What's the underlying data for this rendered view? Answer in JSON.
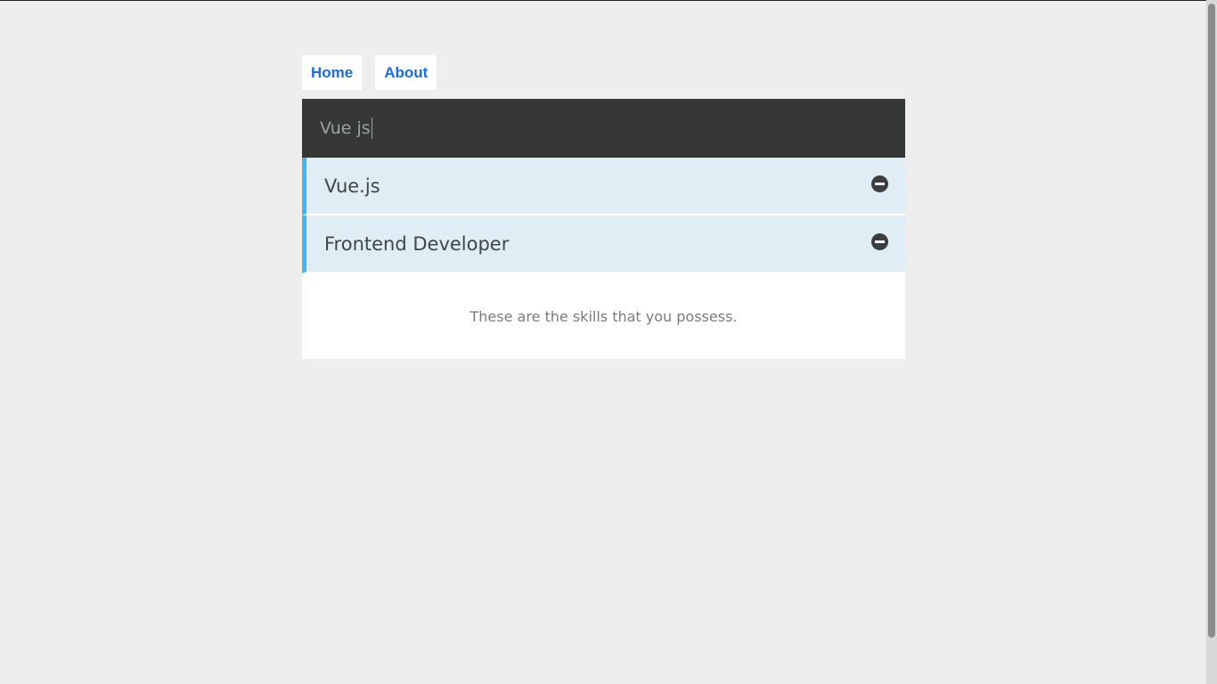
{
  "nav": {
    "home_label": "Home",
    "about_label": "About"
  },
  "search": {
    "value": "Vue js"
  },
  "skills": [
    {
      "label": "Vue.js",
      "icon": "minus-circle-icon"
    },
    {
      "label": "Frontend Developer",
      "icon": "minus-circle-icon"
    }
  ],
  "footer": {
    "text": "These are the skills that you possess."
  },
  "colors": {
    "background": "#eeeeee",
    "nav_link": "#1a6ddb",
    "search_bg": "#363737",
    "item_bg": "#e0edf5",
    "item_accent": "#4ab2ec"
  }
}
